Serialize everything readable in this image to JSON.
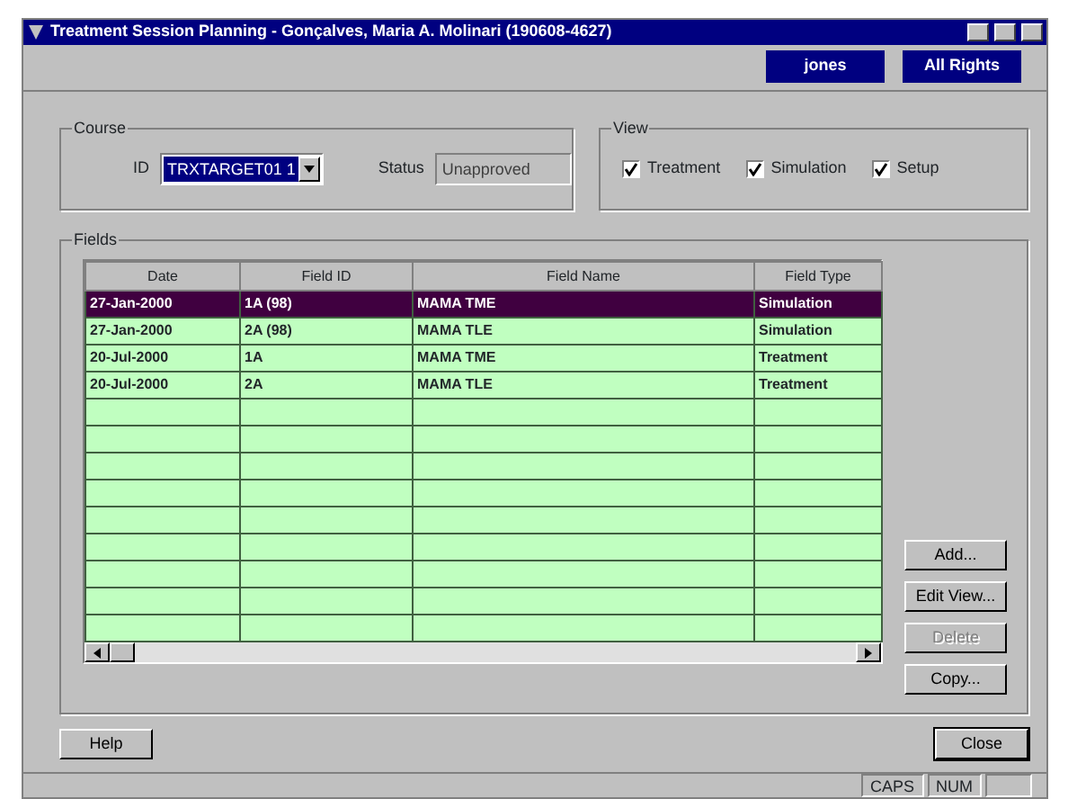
{
  "window": {
    "title": "Treatment Session Planning - Gonçalves, Maria A. Molinari (190608-4627)"
  },
  "toolbar": {
    "buttons": [
      "jones",
      "All Rights"
    ]
  },
  "course": {
    "label": "Course",
    "id_label": "ID",
    "id_value": "TRXTARGET01 1",
    "status_label": "Status",
    "status_value": "Unapproved"
  },
  "view": {
    "label": "View",
    "options": [
      {
        "label": "Treatment",
        "checked": true
      },
      {
        "label": "Simulation",
        "checked": true
      },
      {
        "label": "Setup",
        "checked": true
      }
    ]
  },
  "fields": {
    "label": "Fields",
    "columns": [
      "Date",
      "Field ID",
      "Field Name",
      "Field Type"
    ],
    "rows": [
      {
        "cells": [
          "27-Jan-2000",
          "1A (98)",
          "MAMA TME",
          "Simulation"
        ],
        "selected": true
      },
      {
        "cells": [
          "27-Jan-2000",
          "2A (98)",
          "MAMA TLE",
          "Simulation"
        ],
        "selected": false
      },
      {
        "cells": [
          "20-Jul-2000",
          "1A",
          "MAMA TME",
          "Treatment"
        ],
        "selected": false
      },
      {
        "cells": [
          "20-Jul-2000",
          "2A",
          "MAMA TLE",
          "Treatment"
        ],
        "selected": false
      }
    ],
    "buttons": [
      {
        "label": "Add...",
        "disabled": false
      },
      {
        "label": "Edit View...",
        "disabled": false
      },
      {
        "label": "Delete",
        "disabled": true
      },
      {
        "label": "Copy...",
        "disabled": false
      }
    ]
  },
  "footer": {
    "help": "Help",
    "close": "Close"
  },
  "status_bar": [
    "CAPS",
    "NUM"
  ]
}
